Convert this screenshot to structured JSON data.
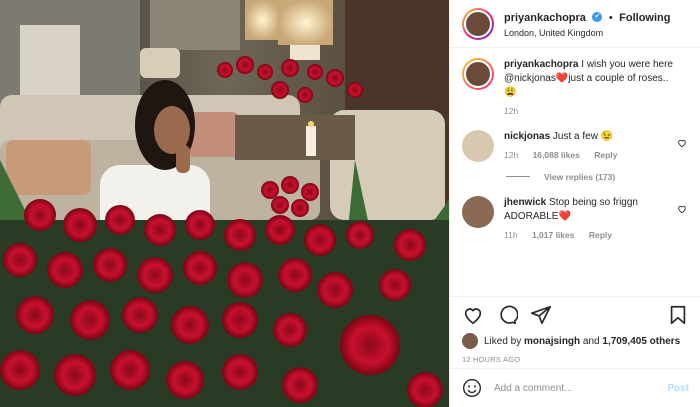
{
  "header": {
    "username": "priyankachopra",
    "verified_mark": "✔",
    "separator": "•",
    "follow_status": "Following",
    "location": "London, United Kingdom"
  },
  "comments": [
    {
      "username": "priyankachopra",
      "text": " I wish you were here @nickjonas❤️just a couple of roses..😩",
      "time": "12h"
    },
    {
      "username": "nickjonas",
      "text": " Just a few 😉",
      "time": "12h",
      "likes": "16,088 likes",
      "reply": "Reply",
      "view_replies": "View replies (173)"
    },
    {
      "username": "jhenwick",
      "text": " Stop being so friggn ADORABLE❤️",
      "time": "11h",
      "likes": "1,017 likes",
      "reply": "Reply"
    }
  ],
  "post": {
    "liked_by_prefix": "Liked by ",
    "liked_by_user": "monajsingh",
    "liked_by_suffix": " and ",
    "liked_count": "1,709,405 others",
    "timestamp": "12 HOURS AGO"
  },
  "add_comment": {
    "placeholder": "Add a comment...",
    "post_label": "Post"
  },
  "icons": {
    "header_avatar": "avatar",
    "like": "heart-icon",
    "comment": "comment-icon",
    "share": "share-icon",
    "save": "bookmark-icon",
    "emoji": "emoji-icon"
  },
  "colors": {
    "verified": "#3897f0",
    "link": "#00376b",
    "post_button": "#b3dbff",
    "rose": "#c8102e"
  }
}
